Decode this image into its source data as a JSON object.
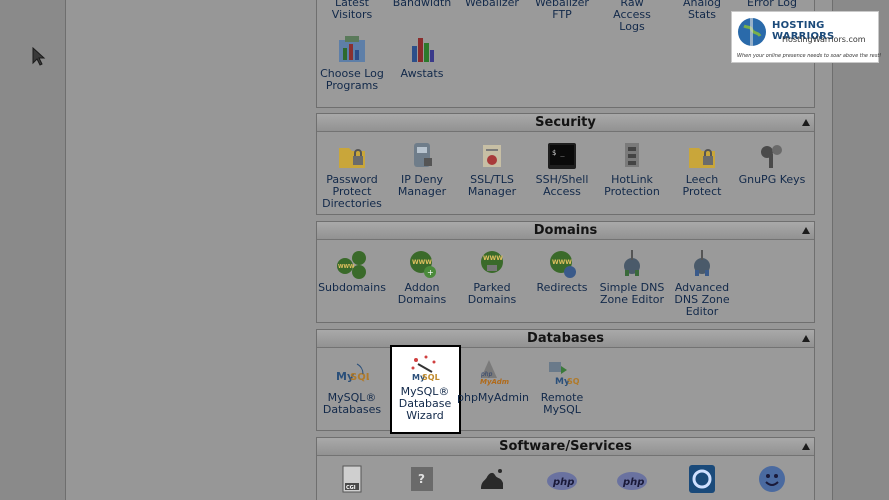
{
  "logo": {
    "title": "HOSTING WARRIORS",
    "url": "HostingWarriors.com",
    "tagline": "When your online presence needs to soar above the rest!"
  },
  "logs": {
    "top_items": [
      "Latest\nVisitors",
      "Bandwidth",
      "Webalizer",
      "Webalizer\nFTP",
      "Raw\nAccess\nLogs",
      "Analog\nStats",
      "Error Log"
    ],
    "items": [
      {
        "label": "Choose Log Programs",
        "icon": "chart-icon"
      },
      {
        "label": "Awstats",
        "icon": "bar-chart-icon"
      }
    ]
  },
  "security": {
    "title": "Security",
    "items": [
      {
        "label": "Password Protect Directories",
        "icon": "folder-lock-icon"
      },
      {
        "label": "IP Deny Manager",
        "icon": "ip-deny-icon"
      },
      {
        "label": "SSL/TLS Manager",
        "icon": "certificate-icon"
      },
      {
        "label": "SSH/Shell Access",
        "icon": "terminal-icon"
      },
      {
        "label": "HotLink Protection",
        "icon": "chain-icon"
      },
      {
        "label": "Leech Protect",
        "icon": "folder-lock-icon"
      },
      {
        "label": "GnuPG Keys",
        "icon": "keys-icon"
      }
    ]
  },
  "domains": {
    "title": "Domains",
    "items": [
      {
        "label": "Subdomains",
        "icon": "www-icon"
      },
      {
        "label": "Addon Domains",
        "icon": "www-add-icon"
      },
      {
        "label": "Parked Domains",
        "icon": "www-parked-icon"
      },
      {
        "label": "Redirects",
        "icon": "www-redirect-icon"
      },
      {
        "label": "Simple DNS Zone Editor",
        "icon": "dns-icon"
      },
      {
        "label": "Advanced DNS Zone Editor",
        "icon": "dns-advanced-icon"
      }
    ]
  },
  "databases": {
    "title": "Databases",
    "items": [
      {
        "label": "MySQL® Databases",
        "icon": "mysql-icon"
      },
      {
        "label": "MySQL® Database Wizard",
        "icon": "mysql-wizard-icon"
      },
      {
        "label": "phpMyAdmin",
        "icon": "phpmyadmin-icon"
      },
      {
        "label": "Remote MySQL",
        "icon": "remote-mysql-icon"
      }
    ]
  },
  "software": {
    "title": "Software/Services",
    "items": [
      {
        "label": "CGI",
        "icon": "cgi-icon"
      },
      {
        "label": "",
        "icon": "help-book-icon"
      },
      {
        "label": "",
        "icon": "perl-camel-icon"
      },
      {
        "label": "php",
        "icon": "php-icon"
      },
      {
        "label": "php",
        "icon": "php-icon"
      },
      {
        "label": "",
        "icon": "installer-icon"
      },
      {
        "label": "",
        "icon": "smiley-icon"
      }
    ]
  },
  "colors": {
    "page_bg": "#979797",
    "link": "#12294a",
    "highlight_border": "#000000"
  }
}
